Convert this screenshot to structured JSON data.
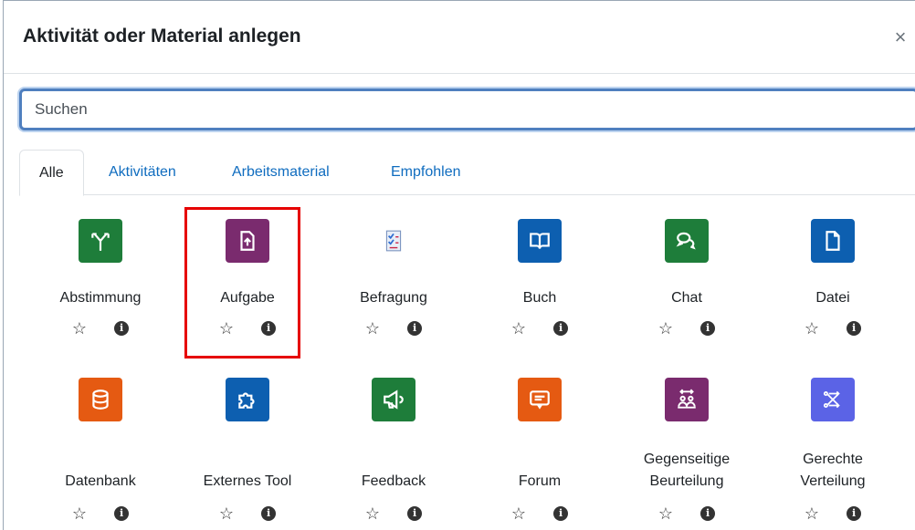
{
  "dialog": {
    "title": "Aktivität oder Material anlegen",
    "close_symbol": "×"
  },
  "search": {
    "placeholder": "Suchen"
  },
  "tabs": [
    {
      "label": "Alle",
      "active": true
    },
    {
      "label": "Aktivitäten",
      "active": false
    },
    {
      "label": "Arbeitsmaterial",
      "active": false
    },
    {
      "label": "Empfohlen",
      "active": false
    }
  ],
  "colors": {
    "green": "#1e7d3a",
    "purple": "#7a2b6e",
    "blue": "#0d5fb0",
    "orange": "#e55a12",
    "violet": "#5b63e6",
    "highlight": "#e60000"
  },
  "items": [
    {
      "label": "Abstimmung",
      "icon": "choice-icon",
      "color": "green"
    },
    {
      "label": "Aufgabe",
      "icon": "assignment-upload-icon",
      "color": "purple"
    },
    {
      "label": "Befragung",
      "icon": "survey-icon",
      "color": "none"
    },
    {
      "label": "Buch",
      "icon": "book-icon",
      "color": "blue"
    },
    {
      "label": "Chat",
      "icon": "chat-icon",
      "color": "green"
    },
    {
      "label": "Datei",
      "icon": "file-icon",
      "color": "blue"
    },
    {
      "label": "Datenbank",
      "icon": "database-icon",
      "color": "orange"
    },
    {
      "label": "Externes Tool",
      "icon": "puzzle-icon",
      "color": "blue"
    },
    {
      "label": "Feedback",
      "icon": "megaphone-icon",
      "color": "green"
    },
    {
      "label": "Forum",
      "icon": "forum-icon",
      "color": "orange"
    },
    {
      "label": "Gegenseitige",
      "label2": "Beurteilung",
      "icon": "workshop-icon",
      "color": "purple"
    },
    {
      "label": "Gerechte",
      "label2": "Verteilung",
      "icon": "ratingallocate-icon",
      "color": "violet"
    }
  ],
  "actions": {
    "star_symbol": "☆",
    "info_symbol": "i"
  }
}
